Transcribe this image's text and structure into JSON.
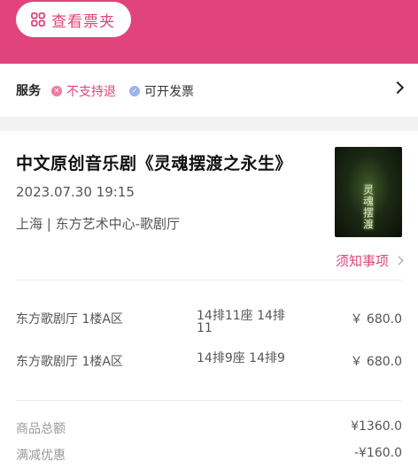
{
  "header": {
    "ticket_folder_label": "查看票夹",
    "ticket_folder_icon": "grid-icon",
    "accent": "#e0447a"
  },
  "service": {
    "title": "服务",
    "items": [
      {
        "label": "不支持退",
        "icon": "close-circle-icon",
        "color": "#e0447a"
      },
      {
        "label": "可开发票",
        "icon": "check-circle-icon",
        "color": "#9ab3e8"
      }
    ]
  },
  "show": {
    "title": "中文原创音乐剧《灵魂摆渡之永生》",
    "datetime": "2023.07.30 19:15",
    "venue": "上海 | 东方艺术中心-歌剧厅",
    "poster_text": "灵魂摆渡",
    "notice_label": "须知事项"
  },
  "tickets": [
    {
      "area": "东方歌剧厅 1楼A区",
      "seat": "14排11座 14排11",
      "price": "￥ 680.0"
    },
    {
      "area": "东方歌剧厅 1楼A区",
      "seat": "14排9座 14排9",
      "price": "￥ 680.0"
    }
  ],
  "summary": [
    {
      "label": "商品总额",
      "value": "¥1360.0"
    },
    {
      "label": "满减优惠",
      "value": "-¥160.0"
    }
  ]
}
